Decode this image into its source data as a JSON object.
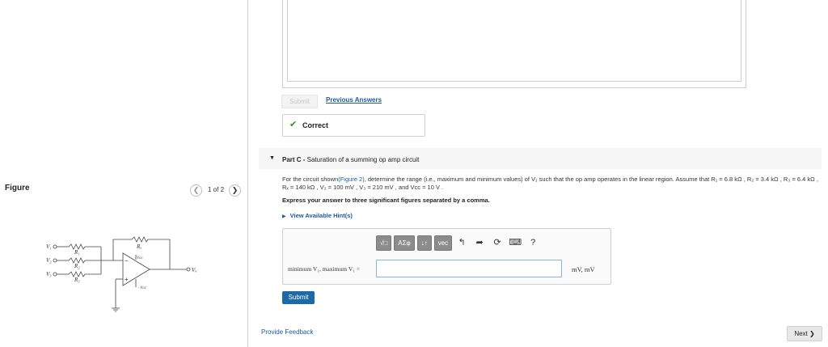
{
  "figure": {
    "label": "Figure",
    "count": "1 of 2",
    "prev_icon": "chevron-left-icon",
    "next_icon": "chevron-right-icon",
    "circuit_labels": {
      "v1": "V₁",
      "v2": "V₂",
      "v3": "V₃",
      "vo": "Vₒ",
      "r1": "R₁",
      "r2": "R₂",
      "r3": "R₃",
      "rf": "Rₓ",
      "vcc_pos": "Vᴄᴄ",
      "vcc_neg": "−Vᴄᴄ",
      "plus": "+",
      "minus": "−"
    }
  },
  "previous_part": {
    "submit_label": "Submit",
    "previous_answers_label": "Previous Answers",
    "status_text": "Correct",
    "status_icon": "checkmark-icon"
  },
  "part_c": {
    "prefix": "Part C - ",
    "title": "Saturation of a summing op amp circuit",
    "question_lead": "For the circuit shown",
    "figure_link": "(Figure 2)",
    "question_body": ", determine the range (i.e., maximum and minimum values) of V₁ such that the op amp operates in the linear region. Assume that R₁ = 6.8 kΩ , R₂ = 3.4 kΩ , R₃ = 6.4 kΩ , Rₓ = 140 kΩ , V₂ = 100 mV , V₃ = 210 mV , and Vᴄᴄ = 10 V .",
    "instruction": "Express your answer to three significant figures separated by a comma.",
    "hints_label": "View Available Hint(s)",
    "toolbar": {
      "templates_label": "√□",
      "symbols_label": "AΣφ",
      "arrows_label": "↓↑",
      "vec_label": "vec"
    },
    "input_label": "minimum V₁, maximum V₁ =",
    "input_value": "",
    "units": "mV, mV",
    "submit_label": "Submit"
  },
  "footer": {
    "feedback_label": "Provide Feedback",
    "next_label": "Next ❯"
  },
  "colors": {
    "accent": "#1c6aa8",
    "link": "#1a5b9a",
    "success": "#3a8a22"
  }
}
